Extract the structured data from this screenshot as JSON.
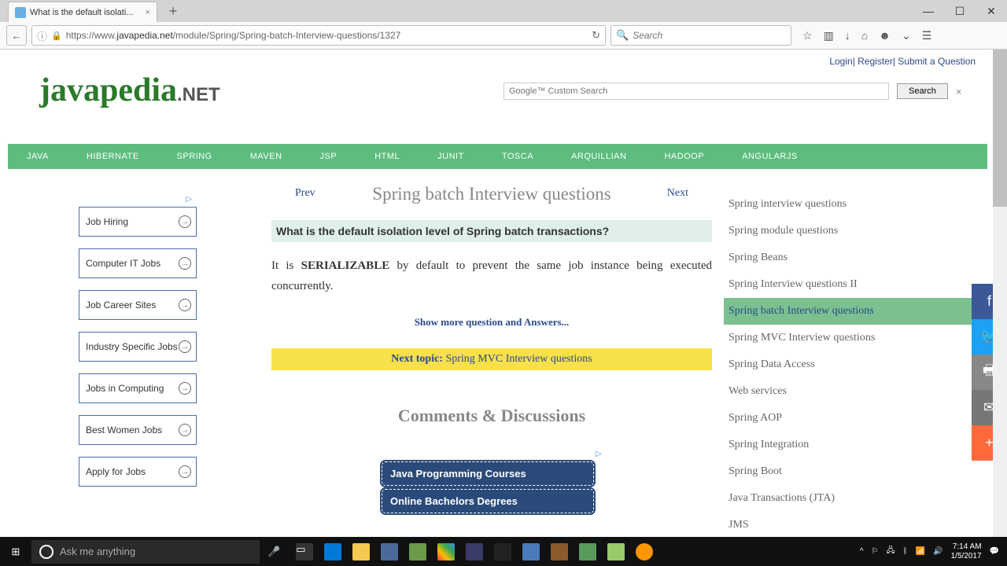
{
  "browser": {
    "tab_title": "What is the default isolati...",
    "url_prefix": "https://www.",
    "url_domain": "javapedia.net",
    "url_path": "/module/Spring/Spring-batch-Interview-questions/1327",
    "search_placeholder": "Search"
  },
  "header": {
    "login": "Login",
    "register": "Register",
    "submit": "Submit a Question",
    "logo_main": "javapedia",
    "logo_suffix": ".NET",
    "custom_search_placeholder": "Google™ Custom Search",
    "search_btn": "Search"
  },
  "menu": [
    "JAVA",
    "HIBERNATE",
    "SPRING",
    "MAVEN",
    "JSP",
    "HTML",
    "JUNIT",
    "TOSCA",
    "ARQUILLIAN",
    "HADOOP",
    "ANGULARJS"
  ],
  "ads_left": [
    "Job Hiring",
    "Computer IT Jobs",
    "Job Career Sites",
    "Industry Specific Jobs",
    "Jobs in Computing",
    "Best Women Jobs",
    "Apply for Jobs"
  ],
  "main": {
    "prev": "Prev",
    "next": "Next",
    "title": "Spring batch Interview questions",
    "question": "What is the default isolation level of Spring batch transactions?",
    "answer_pre": "It is ",
    "answer_bold": "SERIALIZABLE",
    "answer_post": " by default to prevent the same job instance being executed concurrently.",
    "show_more": "Show more question and Answers...",
    "next_label": "Next topic: ",
    "next_value": "Spring MVC Interview questions",
    "comments": "Comments & Discussions",
    "ad_btns": [
      "Java Programming Courses",
      "Online Bachelors Degrees"
    ]
  },
  "sidebar": [
    {
      "label": "Spring interview questions",
      "active": false
    },
    {
      "label": "Spring module questions",
      "active": false
    },
    {
      "label": "Spring Beans",
      "active": false
    },
    {
      "label": "Spring Interview questions II",
      "active": false
    },
    {
      "label": "Spring batch Interview questions",
      "active": true
    },
    {
      "label": "Spring MVC Interview questions",
      "active": false
    },
    {
      "label": "Spring Data Access",
      "active": false
    },
    {
      "label": "Web services",
      "active": false
    },
    {
      "label": "Spring AOP",
      "active": false
    },
    {
      "label": "Spring Integration",
      "active": false
    },
    {
      "label": "Spring Boot",
      "active": false
    },
    {
      "label": "Java Transactions (JTA)",
      "active": false
    },
    {
      "label": "JMS",
      "active": false
    }
  ],
  "taskbar": {
    "cortana": "Ask me anything",
    "time": "7:14 AM",
    "date": "1/5/2017"
  }
}
